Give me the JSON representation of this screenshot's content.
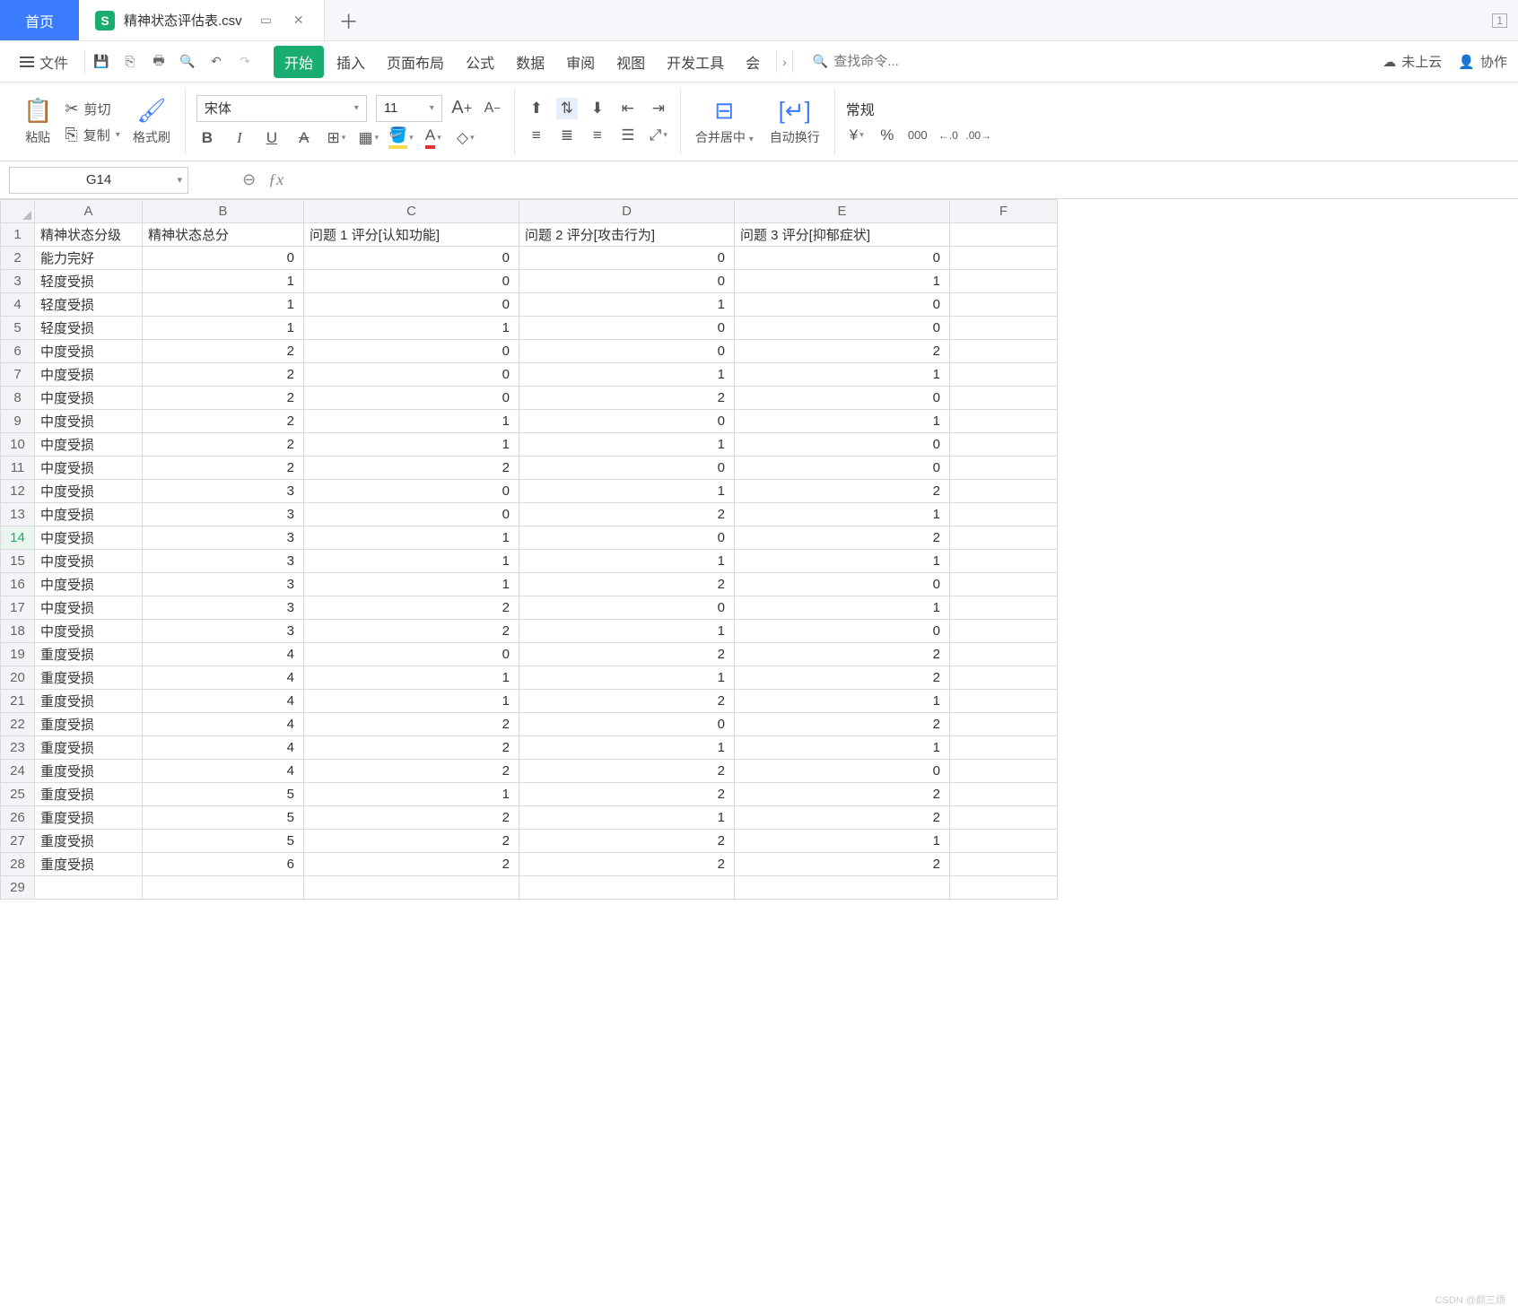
{
  "titlebar": {
    "home": "首页",
    "doc_name": "精神状态评估表.csv",
    "window_indicator": "1"
  },
  "menubar": {
    "file": "文件",
    "search_placeholder": "查找命令...",
    "tabs": [
      "开始",
      "插入",
      "页面布局",
      "公式",
      "数据",
      "审阅",
      "视图",
      "开发工具",
      "会"
    ],
    "active_tab_index": 0,
    "cloud": "未上云",
    "collab": "协作"
  },
  "ribbon": {
    "paste": "粘贴",
    "cut": "剪切",
    "copy": "复制",
    "format_painter": "格式刷",
    "font_name": "宋体",
    "font_size": "11",
    "inc_font": "A⁺",
    "dec_font": "A⁻",
    "merge": "合并居中",
    "wrap": "自动换行",
    "number_format": "常规"
  },
  "fxbar": {
    "name_box": "G14",
    "formula": ""
  },
  "grid": {
    "columns": [
      "A",
      "B",
      "C",
      "D",
      "E",
      "F"
    ],
    "active_row": 14,
    "headers": [
      "精神状态分级",
      "精神状态总分",
      "问题 1 评分[认知功能]",
      "问题 2 评分[攻击行为]",
      "问题 3 评分[抑郁症状]"
    ],
    "rows": [
      [
        "能力完好",
        0,
        0,
        0,
        0
      ],
      [
        "轻度受损",
        1,
        0,
        0,
        1
      ],
      [
        "轻度受损",
        1,
        0,
        1,
        0
      ],
      [
        "轻度受损",
        1,
        1,
        0,
        0
      ],
      [
        "中度受损",
        2,
        0,
        0,
        2
      ],
      [
        "中度受损",
        2,
        0,
        1,
        1
      ],
      [
        "中度受损",
        2,
        0,
        2,
        0
      ],
      [
        "中度受损",
        2,
        1,
        0,
        1
      ],
      [
        "中度受损",
        2,
        1,
        1,
        0
      ],
      [
        "中度受损",
        2,
        2,
        0,
        0
      ],
      [
        "中度受损",
        3,
        0,
        1,
        2
      ],
      [
        "中度受损",
        3,
        0,
        2,
        1
      ],
      [
        "中度受损",
        3,
        1,
        0,
        2
      ],
      [
        "中度受损",
        3,
        1,
        1,
        1
      ],
      [
        "中度受损",
        3,
        1,
        2,
        0
      ],
      [
        "中度受损",
        3,
        2,
        0,
        1
      ],
      [
        "中度受损",
        3,
        2,
        1,
        0
      ],
      [
        "重度受损",
        4,
        0,
        2,
        2
      ],
      [
        "重度受损",
        4,
        1,
        1,
        2
      ],
      [
        "重度受损",
        4,
        1,
        2,
        1
      ],
      [
        "重度受损",
        4,
        2,
        0,
        2
      ],
      [
        "重度受损",
        4,
        2,
        1,
        1
      ],
      [
        "重度受损",
        4,
        2,
        2,
        0
      ],
      [
        "重度受损",
        5,
        1,
        2,
        2
      ],
      [
        "重度受损",
        5,
        2,
        1,
        2
      ],
      [
        "重度受损",
        5,
        2,
        2,
        1
      ],
      [
        "重度受损",
        6,
        2,
        2,
        2
      ]
    ],
    "blank_rows_after": 1
  },
  "watermark": "CSDN @颜三烦"
}
